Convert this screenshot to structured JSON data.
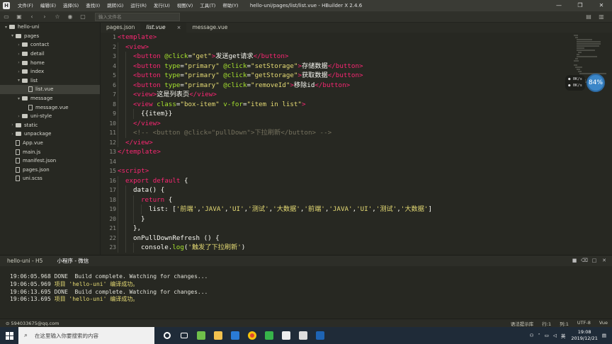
{
  "titlebar": {
    "menu": [
      "文件(F)",
      "编辑(E)",
      "选择(S)",
      "查找(I)",
      "跳转(G)",
      "运行(R)",
      "发行(U)",
      "视图(V)",
      "工具(T)",
      "帮助(Y)"
    ],
    "window_title": "hello-uni/pages/list/list.vue - HBuilder X 2.4.6"
  },
  "toolbar": {
    "input_placeholder": "输入文件名"
  },
  "sidebar": {
    "items": [
      {
        "label": "hello-uni",
        "arrow": "▾",
        "kind": "folder",
        "depth": 0
      },
      {
        "label": "pages",
        "arrow": "▾",
        "kind": "folder",
        "depth": 1
      },
      {
        "label": "contact",
        "arrow": "›",
        "kind": "folder",
        "depth": 2
      },
      {
        "label": "detail",
        "arrow": "›",
        "kind": "folder",
        "depth": 2
      },
      {
        "label": "home",
        "arrow": "›",
        "kind": "folder",
        "depth": 2
      },
      {
        "label": "index",
        "arrow": "›",
        "kind": "folder",
        "depth": 2
      },
      {
        "label": "list",
        "arrow": "▾",
        "kind": "folder",
        "depth": 2
      },
      {
        "label": "list.vue",
        "arrow": "",
        "kind": "file",
        "depth": 3,
        "selected": true
      },
      {
        "label": "message",
        "arrow": "▾",
        "kind": "folder",
        "depth": 2
      },
      {
        "label": "message.vue",
        "arrow": "",
        "kind": "file",
        "depth": 3
      },
      {
        "label": "uni-style",
        "arrow": "›",
        "kind": "folder",
        "depth": 2
      },
      {
        "label": "static",
        "arrow": "›",
        "kind": "folder",
        "depth": 1
      },
      {
        "label": "unpackage",
        "arrow": "›",
        "kind": "folder",
        "depth": 1
      },
      {
        "label": "App.vue",
        "arrow": "",
        "kind": "file",
        "depth": 1
      },
      {
        "label": "main.js",
        "arrow": "",
        "kind": "file",
        "depth": 1
      },
      {
        "label": "manifest.json",
        "arrow": "",
        "kind": "file",
        "depth": 1
      },
      {
        "label": "pages.json",
        "arrow": "",
        "kind": "file",
        "depth": 1
      },
      {
        "label": "uni.scss",
        "arrow": "",
        "kind": "file",
        "depth": 1
      }
    ]
  },
  "tabs": [
    {
      "label": "pages.json",
      "active": false
    },
    {
      "label": "list.vue",
      "active": true
    },
    {
      "label": "message.vue",
      "active": false
    }
  ],
  "editor": {
    "line_numbers": [
      "1",
      "2",
      "3",
      "4",
      "5",
      "6",
      "7",
      "8",
      "9",
      "10",
      "11",
      "12",
      "13",
      "14",
      "15",
      "16",
      "17",
      "18",
      "19",
      "20",
      "21",
      "22",
      "23"
    ],
    "lines": [
      {
        "indent": 0,
        "parts": [
          [
            "tag",
            "<template>"
          ]
        ]
      },
      {
        "indent": 1,
        "parts": [
          [
            "tag",
            "<view>"
          ]
        ]
      },
      {
        "indent": 2,
        "parts": [
          [
            "tag",
            "<button "
          ],
          [
            "attr",
            "@click"
          ],
          [
            "p",
            "="
          ],
          [
            "str",
            "\"get\""
          ],
          [
            "tag",
            ">"
          ],
          [
            "p",
            "发送get请求"
          ],
          [
            "tag",
            "</button>"
          ]
        ]
      },
      {
        "indent": 2,
        "parts": [
          [
            "tag",
            "<button "
          ],
          [
            "attr",
            "type"
          ],
          [
            "p",
            "="
          ],
          [
            "str",
            "\"primary\" "
          ],
          [
            "attr",
            "@click"
          ],
          [
            "p",
            "="
          ],
          [
            "str",
            "\"setStorage\""
          ],
          [
            "tag",
            ">"
          ],
          [
            "p",
            "存储数据"
          ],
          [
            "tag",
            "</button>"
          ]
        ]
      },
      {
        "indent": 2,
        "parts": [
          [
            "tag",
            "<button "
          ],
          [
            "attr",
            "type"
          ],
          [
            "p",
            "="
          ],
          [
            "str",
            "\"primary\" "
          ],
          [
            "attr",
            "@click"
          ],
          [
            "p",
            "="
          ],
          [
            "str",
            "\"getStorage\""
          ],
          [
            "tag",
            ">"
          ],
          [
            "p",
            "获取数据"
          ],
          [
            "tag",
            "</button>"
          ]
        ]
      },
      {
        "indent": 2,
        "parts": [
          [
            "tag",
            "<button "
          ],
          [
            "attr",
            "type"
          ],
          [
            "p",
            "="
          ],
          [
            "str",
            "\"primary\" "
          ],
          [
            "attr",
            "@click"
          ],
          [
            "p",
            "="
          ],
          [
            "str",
            "\"removeId\""
          ],
          [
            "tag",
            ">"
          ],
          [
            "p",
            "移除id"
          ],
          [
            "tag",
            "</button>"
          ]
        ]
      },
      {
        "indent": 2,
        "parts": [
          [
            "tag",
            "<view>"
          ],
          [
            "p",
            "这是列表页"
          ],
          [
            "tag",
            "</view>"
          ]
        ]
      },
      {
        "indent": 2,
        "parts": [
          [
            "tag",
            "<view "
          ],
          [
            "attr",
            "class"
          ],
          [
            "p",
            "="
          ],
          [
            "str",
            "\"box-item\" "
          ],
          [
            "attr",
            "v-for"
          ],
          [
            "p",
            "="
          ],
          [
            "str",
            "\"item in list\""
          ],
          [
            "tag",
            ">"
          ]
        ]
      },
      {
        "indent": 3,
        "parts": [
          [
            "p",
            "{{item}}"
          ]
        ]
      },
      {
        "indent": 2,
        "parts": [
          [
            "tag",
            "</view>"
          ]
        ]
      },
      {
        "indent": 2,
        "parts": [
          [
            "cm",
            "<!-- <button @click=\"pullDown\">下拉刷新</button> -->"
          ]
        ]
      },
      {
        "indent": 1,
        "parts": [
          [
            "tag",
            "</view>"
          ]
        ]
      },
      {
        "indent": 0,
        "parts": [
          [
            "tag",
            "</template>"
          ]
        ]
      },
      {
        "indent": 0,
        "parts": []
      },
      {
        "indent": 0,
        "parts": [
          [
            "tag",
            "<script>"
          ]
        ]
      },
      {
        "indent": 1,
        "parts": [
          [
            "kw",
            "export default "
          ],
          [
            "p",
            "{"
          ]
        ]
      },
      {
        "indent": 2,
        "parts": [
          [
            "p",
            "data() {"
          ]
        ]
      },
      {
        "indent": 3,
        "parts": [
          [
            "kw",
            "return "
          ],
          [
            "p",
            "{"
          ]
        ]
      },
      {
        "indent": 4,
        "parts": [
          [
            "p",
            "list: ["
          ],
          [
            "str",
            "'前端'"
          ],
          [
            "p",
            ","
          ],
          [
            "str",
            "'JAVA'"
          ],
          [
            "p",
            ","
          ],
          [
            "str",
            "'UI'"
          ],
          [
            "p",
            ","
          ],
          [
            "str",
            "'测试'"
          ],
          [
            "p",
            ","
          ],
          [
            "str",
            "'大数据'"
          ],
          [
            "p",
            ","
          ],
          [
            "str",
            "'前端'"
          ],
          [
            "p",
            ","
          ],
          [
            "str",
            "'JAVA'"
          ],
          [
            "p",
            ","
          ],
          [
            "str",
            "'UI'"
          ],
          [
            "p",
            ","
          ],
          [
            "str",
            "'测试'"
          ],
          [
            "p",
            ","
          ],
          [
            "str",
            "'大数据'"
          ],
          [
            "p",
            "]"
          ]
        ]
      },
      {
        "indent": 3,
        "parts": [
          [
            "p",
            "}"
          ]
        ]
      },
      {
        "indent": 2,
        "parts": [
          [
            "p",
            "},"
          ]
        ]
      },
      {
        "indent": 2,
        "parts": [
          [
            "p",
            "onPullDownRefresh () {"
          ]
        ]
      },
      {
        "indent": 3,
        "parts": [
          [
            "p",
            "console."
          ],
          [
            "fn",
            "log"
          ],
          [
            "p",
            "("
          ],
          [
            "str",
            "'触发了下拉刷新'"
          ],
          [
            "p",
            ")"
          ]
        ]
      }
    ]
  },
  "perf": {
    "up": "0K/s",
    "down": "0K/s",
    "percent": "84%"
  },
  "console_tabs": [
    {
      "label": "hello-uni - H5",
      "active": false
    },
    {
      "label": "小程序 - 微信",
      "active": true
    }
  ],
  "console": {
    "lines": [
      {
        "time": "19:06:05.968",
        "text": " DONE  Build complete. Watching for changes...",
        "yellow": false
      },
      {
        "time": "19:06:05.969",
        "text": " 项目 'hello-uni' 编译成功。",
        "yellow": true
      },
      {
        "time": "19:06:13.695",
        "text": " DONE  Build complete. Watching for changes...",
        "yellow": false
      },
      {
        "time": "19:06:13.695",
        "text": " 项目 'hello-uni' 编译成功。",
        "yellow": true
      }
    ]
  },
  "statusbar": {
    "user": "594033675@qq.com",
    "hint": "语法提示库",
    "position_line": "行:1",
    "position_col": "列:1",
    "encoding": "UTF-8",
    "language": "Vue"
  },
  "taskbar": {
    "search_placeholder": "在这里输入你要搜索的内容",
    "ime": "英",
    "time": "19:08",
    "date": "2019/12/21"
  },
  "colors": {
    "accent": "#3b86c8",
    "tag": "#f92672",
    "string": "#e6db74",
    "attr": "#a6e22e",
    "comment": "#75715e"
  }
}
